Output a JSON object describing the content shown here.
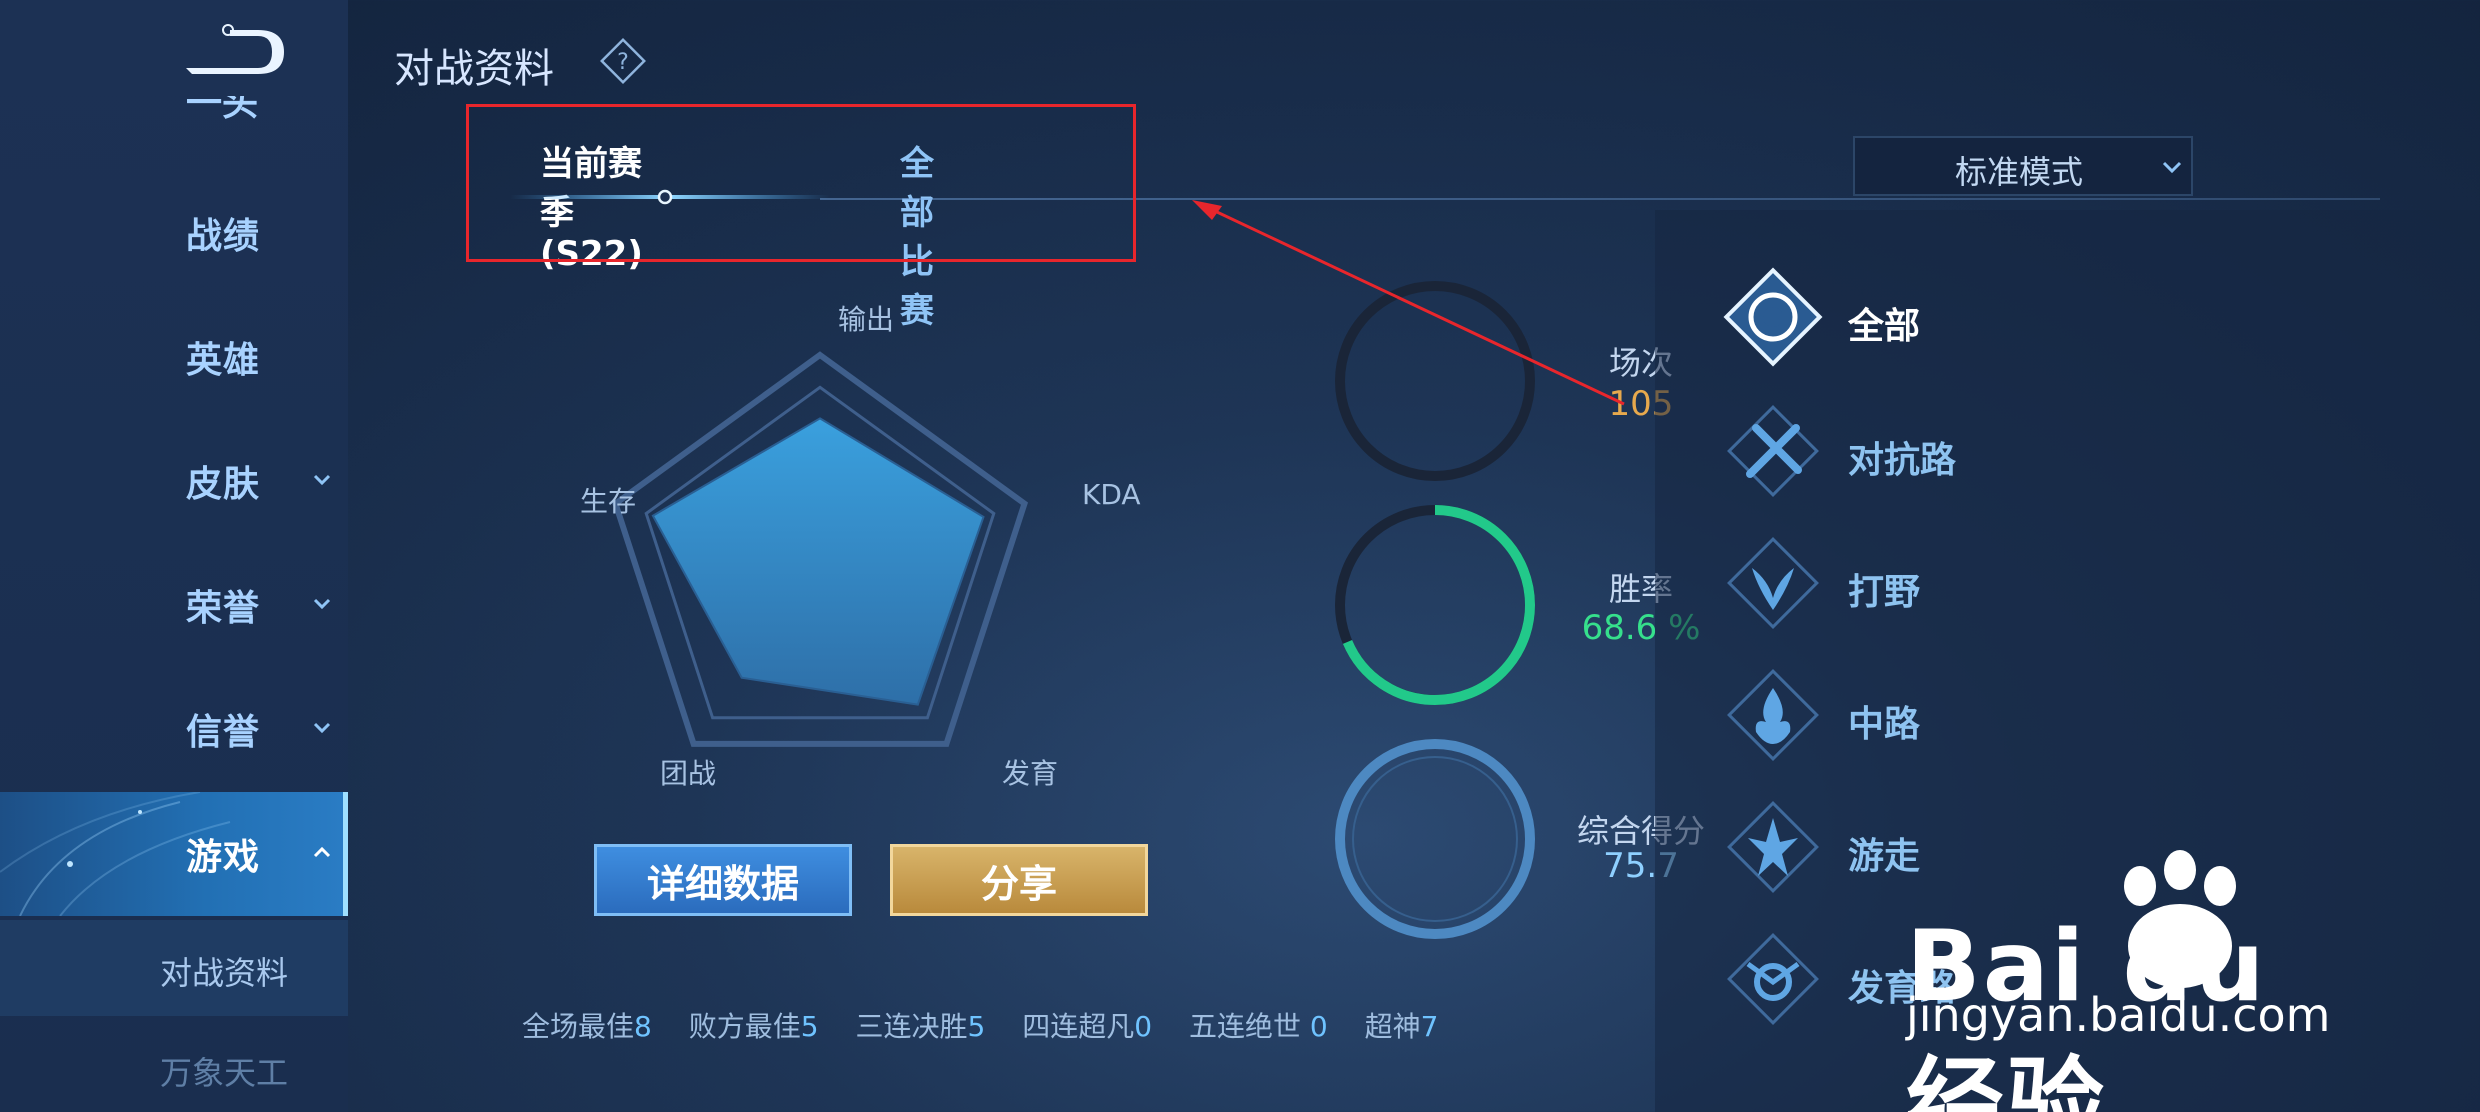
{
  "header": {
    "title": "对战资料"
  },
  "sidebar": {
    "partial_item": "一头",
    "items": [
      {
        "label": "战绩"
      },
      {
        "label": "英雄"
      },
      {
        "label": "皮肤"
      },
      {
        "label": "荣誉"
      },
      {
        "label": "信誉"
      },
      {
        "label": "游戏"
      }
    ],
    "subitems": [
      {
        "label": "对战资料"
      },
      {
        "label": "万象天工"
      }
    ]
  },
  "tabs": [
    {
      "label": "当前赛季(S22)",
      "active": true
    },
    {
      "label": "全部比赛",
      "active": false
    }
  ],
  "mode_select": {
    "value": "标准模式"
  },
  "radar": {
    "labels": [
      "输出",
      "KDA",
      "发育",
      "团战",
      "生存"
    ],
    "values": [
      0.82,
      0.93,
      0.9,
      0.72,
      0.95
    ]
  },
  "buttons": {
    "detail": "详细数据",
    "share": "分享"
  },
  "stats": [
    {
      "label": "全场最佳",
      "value": "8"
    },
    {
      "label": "败方最佳",
      "value": "5"
    },
    {
      "label": "三连决胜",
      "value": "5"
    },
    {
      "label": "四连超凡",
      "value": "0"
    },
    {
      "label": "五连绝世",
      "value": " 0"
    },
    {
      "label": "超神",
      "value": "7"
    }
  ],
  "circles": {
    "games": {
      "label": "场次",
      "value": "105"
    },
    "win_rate": {
      "label": "胜率",
      "value": "68.6 %",
      "fraction": 0.686
    },
    "score": {
      "label": "综合得分",
      "value": "75.7"
    }
  },
  "roles": [
    {
      "label": "全部",
      "icon": "all-roles-icon"
    },
    {
      "label": "对抗路",
      "icon": "clash-lane-icon"
    },
    {
      "label": "打野",
      "icon": "jungle-icon"
    },
    {
      "label": "中路",
      "icon": "mid-lane-icon"
    },
    {
      "label": "游走",
      "icon": "roam-icon"
    },
    {
      "label": "发育路",
      "icon": "farm-lane-icon"
    }
  ],
  "watermark": {
    "logo": "Bai du 经验",
    "url": "jingyan.baidu.com"
  },
  "colors": {
    "highlight": "#e8262c",
    "win_ring": "#22c98a",
    "games_value": "#e7a94d"
  }
}
